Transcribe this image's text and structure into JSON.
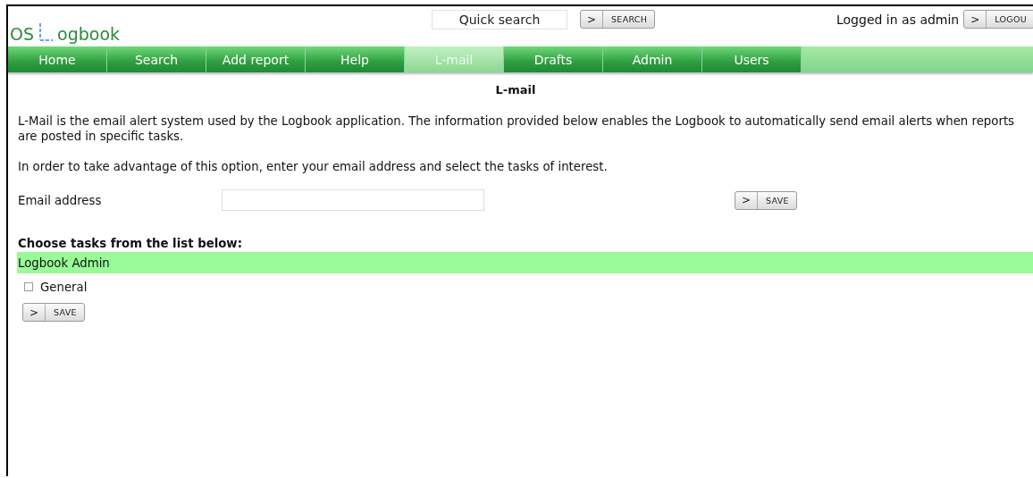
{
  "logo": {
    "before": "OS",
    "after": "ogbook"
  },
  "quick_search": {
    "placeholder": "Quick search",
    "button": {
      "arrow": ">",
      "label": "SEARCH"
    }
  },
  "user": {
    "text": "Logged in as admin",
    "button": {
      "arrow": ">",
      "label": "LOGOU"
    }
  },
  "nav": [
    {
      "label": "Home",
      "selected": false
    },
    {
      "label": "Search",
      "selected": false
    },
    {
      "label": "Add report",
      "selected": false
    },
    {
      "label": "Help",
      "selected": false
    },
    {
      "label": "L-mail",
      "selected": true
    },
    {
      "label": "Drafts",
      "selected": false
    },
    {
      "label": "Admin",
      "selected": false
    },
    {
      "label": "Users",
      "selected": false
    }
  ],
  "page_title": "L-mail",
  "paragraphs": [
    "L-Mail is the email alert system used by the Logbook application. The information provided below enables the Logbook to automatically send email alerts when reports are posted in specific tasks.",
    "In order to take advantage of this option, enter your email address and select the tasks of interest."
  ],
  "email": {
    "label": "Email address",
    "button": {
      "arrow": ">",
      "label": "SAVE"
    }
  },
  "tasks_heading": "Choose tasks from the list below:",
  "task_groups": [
    {
      "name": "Logbook Admin",
      "tasks": [
        {
          "label": "General",
          "checked": false
        }
      ]
    }
  ],
  "save_button": {
    "arrow": ">",
    "label": "SAVE"
  }
}
